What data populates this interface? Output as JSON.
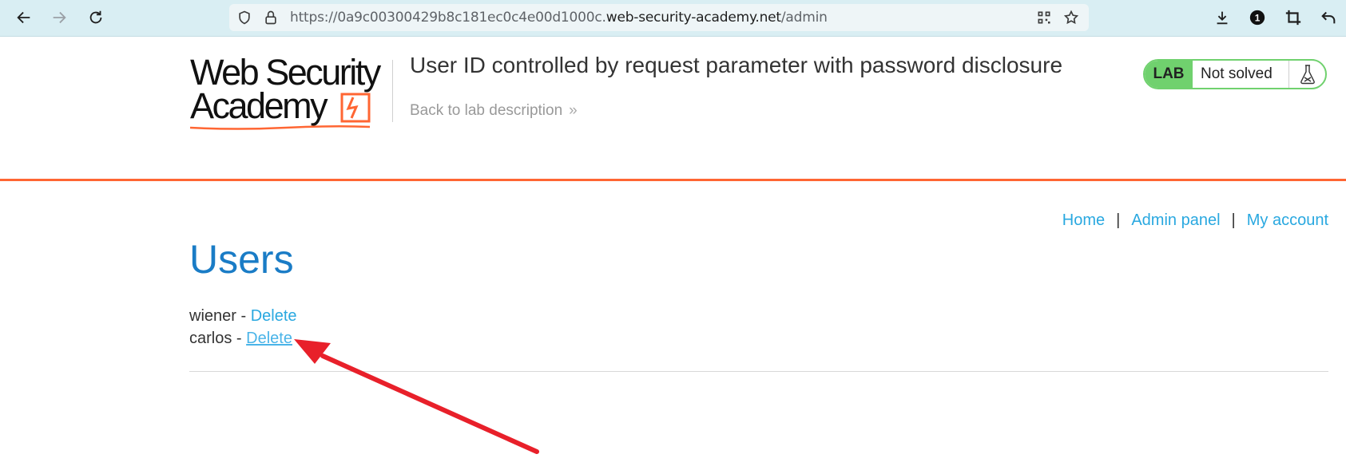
{
  "browser": {
    "url_prefix": "https://0a9c00300429b8c181ec0c4e00d1000c.",
    "url_host": "web-security-academy.net",
    "url_path": "/admin",
    "icons": [
      "back-arrow-icon",
      "forward-arrow-icon",
      "reload-icon",
      "shield-icon",
      "lock-icon",
      "qr-code-icon",
      "star-icon",
      "download-icon",
      "extension-badge-icon",
      "crop-icon",
      "undo-icon"
    ],
    "badge_count": "1"
  },
  "header": {
    "logo_line1": "Web Security",
    "logo_line2": "Academy",
    "lab_title": "User ID controlled by request parameter with password disclosure",
    "back_link": "Back to lab description",
    "status_tag": "LAB",
    "status_text": "Not solved",
    "brand_color": "#ff6633",
    "solved_color": "#70d16e"
  },
  "nav": {
    "home": "Home",
    "separator": "|",
    "admin_panel": "Admin panel",
    "my_account": "My account"
  },
  "main": {
    "heading": "Users",
    "users": [
      {
        "name": "wiener",
        "dash": " - ",
        "action": "Delete"
      },
      {
        "name": "carlos",
        "dash": " - ",
        "action": "Delete"
      }
    ]
  },
  "annotation": {
    "arrow_color": "#e8202a",
    "target": "carlos-delete-link"
  }
}
